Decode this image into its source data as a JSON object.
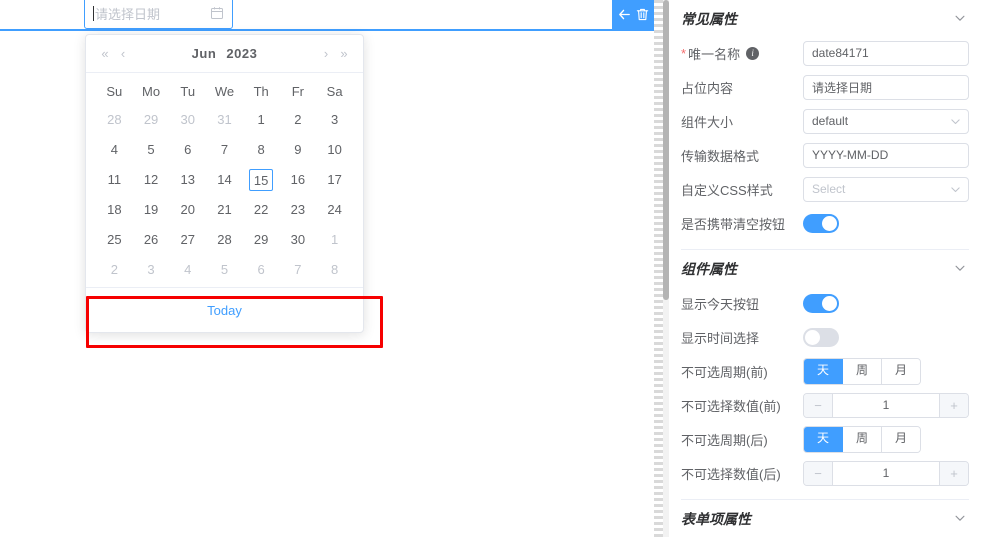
{
  "canvas": {
    "date_field": {
      "placeholder": "请选择日期",
      "value": "",
      "calendar_icon": "calendar-icon"
    },
    "item_toolbar": {
      "back_icon": "arrow-left-icon",
      "delete_icon": "trash-icon"
    }
  },
  "picker": {
    "prev_year_label": "«",
    "prev_month_label": "‹",
    "next_month_label": "›",
    "next_year_label": "»",
    "month_label": "Jun",
    "year_label": "2023",
    "weekdays": [
      "Su",
      "Mo",
      "Tu",
      "We",
      "Th",
      "Fr",
      "Sa"
    ],
    "weeks": [
      [
        {
          "d": "28",
          "other": true
        },
        {
          "d": "29",
          "other": true
        },
        {
          "d": "30",
          "other": true
        },
        {
          "d": "31",
          "other": true
        },
        {
          "d": "1"
        },
        {
          "d": "2"
        },
        {
          "d": "3"
        }
      ],
      [
        {
          "d": "4"
        },
        {
          "d": "5"
        },
        {
          "d": "6"
        },
        {
          "d": "7"
        },
        {
          "d": "8"
        },
        {
          "d": "9"
        },
        {
          "d": "10"
        }
      ],
      [
        {
          "d": "11"
        },
        {
          "d": "12"
        },
        {
          "d": "13"
        },
        {
          "d": "14"
        },
        {
          "d": "15",
          "today": true
        },
        {
          "d": "16"
        },
        {
          "d": "17"
        }
      ],
      [
        {
          "d": "18"
        },
        {
          "d": "19"
        },
        {
          "d": "20"
        },
        {
          "d": "21"
        },
        {
          "d": "22"
        },
        {
          "d": "23"
        },
        {
          "d": "24"
        }
      ],
      [
        {
          "d": "25"
        },
        {
          "d": "26"
        },
        {
          "d": "27"
        },
        {
          "d": "28"
        },
        {
          "d": "29"
        },
        {
          "d": "30"
        },
        {
          "d": "1",
          "other": true
        }
      ],
      [
        {
          "d": "2",
          "other": true
        },
        {
          "d": "3",
          "other": true
        },
        {
          "d": "4",
          "other": true
        },
        {
          "d": "5",
          "other": true
        },
        {
          "d": "6",
          "other": true
        },
        {
          "d": "7",
          "other": true
        },
        {
          "d": "8",
          "other": true
        }
      ]
    ],
    "today_label": "Today"
  },
  "panel": {
    "sections": {
      "common": {
        "title": "常见属性",
        "collapse_icon": "chevron-down-icon"
      },
      "component": {
        "title": "组件属性",
        "collapse_icon": "chevron-down-icon"
      },
      "formitem": {
        "title": "表单项属性",
        "collapse_icon": "chevron-down-icon"
      }
    },
    "common_rows": {
      "unique_name": {
        "label": "唯一名称",
        "required": true,
        "info_icon": "info-icon",
        "value": "date84171"
      },
      "placeholder": {
        "label": "占位内容",
        "value": "请选择日期"
      },
      "size": {
        "label": "组件大小",
        "value": "default",
        "arrow_icon": "chevron-down-icon"
      },
      "format": {
        "label": "传输数据格式",
        "value": "YYYY-MM-DD"
      },
      "css": {
        "label": "自定义CSS样式",
        "value": "Select",
        "is_placeholder": true,
        "arrow_icon": "chevron-down-icon"
      },
      "clearable": {
        "label": "是否携带清空按钮",
        "on": true
      }
    },
    "component_rows": {
      "show_today": {
        "label": "显示今天按钮",
        "on": true
      },
      "show_time": {
        "label": "显示时间选择",
        "on": false
      },
      "period_before": {
        "label": "不可选周期(前)",
        "options": [
          "天",
          "周",
          "月"
        ],
        "selected": "天"
      },
      "value_before": {
        "label": "不可选择数值(前)",
        "value": "1",
        "minus": "−",
        "plus": "+"
      },
      "period_after": {
        "label": "不可选周期(后)",
        "options": [
          "天",
          "周",
          "月"
        ],
        "selected": "天"
      },
      "value_after": {
        "label": "不可选择数值(后)",
        "value": "1",
        "minus": "−",
        "plus": "+"
      }
    }
  },
  "colors": {
    "accent": "#409eff",
    "annotation": "#f60000",
    "toggle_off": "#dcdfe6",
    "required": "#f56c6c"
  }
}
